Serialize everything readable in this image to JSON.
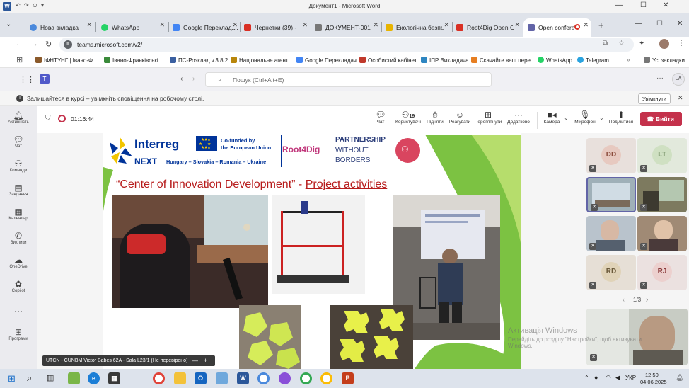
{
  "word": {
    "title": "Документ1 - Microsoft Word",
    "app_icon": "W",
    "quick_access": [
      "↶",
      "↷",
      "⊙",
      "▾"
    ],
    "window_controls": [
      "—",
      "☐",
      "✕"
    ]
  },
  "browser": {
    "tabs": [
      {
        "label": "Нова вкладка",
        "icon": "chrome-icon",
        "color": "#4a89dc"
      },
      {
        "label": "WhatsApp",
        "icon": "whatsapp-icon",
        "color": "#25d366"
      },
      {
        "label": "Google Перекладач",
        "icon": "translate-icon",
        "color": "#4285f4"
      },
      {
        "label": "Чернетки (39) - ",
        "icon": "gmail-icon",
        "color": "#d93025"
      },
      {
        "label": "ДОКУМЕНТ-001",
        "icon": "doc-icon",
        "color": "#555555"
      },
      {
        "label": "Екологічна безпе",
        "icon": "bookmark-icon",
        "color": "#e8b400"
      },
      {
        "label": "Root4Dig Open C",
        "icon": "gmail-icon",
        "color": "#d93025"
      },
      {
        "label": "Open confere",
        "icon": "teams-icon",
        "color": "#6264a7"
      }
    ],
    "new_tab": "+",
    "url": "teams.microsoft.com/v2/",
    "bookmarks": [
      {
        "label": "ІФНТУНГ | Івано-Ф...",
        "color": "#8b5a2b"
      },
      {
        "label": "Івано-Франківські...",
        "color": "#3a8a3a"
      },
      {
        "label": "ПС-Розклад v.3.8.2",
        "color": "#3a5fa0"
      },
      {
        "label": "Національне агент...",
        "color": "#b8860b"
      },
      {
        "label": "Google Перекладач",
        "color": "#4285f4"
      },
      {
        "label": "Особистий кабінет",
        "color": "#c0392b"
      },
      {
        "label": "ІПР Викладача",
        "color": "#2e86c1"
      },
      {
        "label": "Скачайте ваш пере...",
        "color": "#e67e22"
      },
      {
        "label": "WhatsApp",
        "color": "#25d366"
      },
      {
        "label": "Telegram",
        "color": "#2aa3df"
      }
    ],
    "all_bookmarks": "Усі закладки"
  },
  "teams": {
    "search_placeholder": "Пошук (Ctrl+Alt+E)",
    "avatar_initials": "LA",
    "notification": "Залишайтеся в курсі – увімкніть сповіщення на робочому столі.",
    "notification_button": "Увімкнути",
    "rail": [
      "Активність",
      "Чат",
      "Команди",
      "Завдання",
      "Календар",
      "Виклики",
      "OneDrive",
      "Copilot",
      "Програми"
    ]
  },
  "meeting": {
    "timer": "01:16:44",
    "toolbar": [
      {
        "label": "Чат",
        "icon": "chat-icon"
      },
      {
        "label": "Користувачі",
        "icon": "people-icon",
        "count": "19"
      },
      {
        "label": "Підняти",
        "icon": "hand-icon"
      },
      {
        "label": "Реагувати",
        "icon": "emoji-icon"
      },
      {
        "label": "Переглянути",
        "icon": "grid-icon"
      },
      {
        "label": "Додатково",
        "icon": "more-icon"
      },
      {
        "label": "Камера",
        "icon": "camera-icon"
      },
      {
        "label": "Мікрофон",
        "icon": "mic-off-icon"
      },
      {
        "label": "Поділитися",
        "icon": "share-icon"
      }
    ],
    "leave_label": "Вийти",
    "presenter_caption": "UTCN - CUNBM Victor Babes 62A - Sala L23/1 (Не перевірено)",
    "participants": [
      {
        "initials": "DD"
      },
      {
        "initials": "LT"
      },
      {
        "initials": "RD"
      },
      {
        "initials": "RJ"
      }
    ],
    "pager": "1/3"
  },
  "slide": {
    "interreg": "Interreg",
    "next": "NEXT",
    "cofunded_line1": "Co-funded by",
    "cofunded_line2": "the European Union",
    "countries": "Hungary – Slovakia – Romania – Ukraine",
    "project": "Root4Dig",
    "partnership": "PARTNERSHIP",
    "without": "WITHOUT",
    "borders": "BORDERS",
    "title_quoted": "“Center of Innovation Development” - ",
    "title_underlined": "Project activities"
  },
  "watermark": {
    "line1": "Активація Windows",
    "line2": "Перейдіть до розділу \"Настройки\", щоб активувати",
    "line3": "Windows."
  },
  "taskbar": {
    "time": "12:50",
    "date": "04.06.2025",
    "lang": "УКР"
  }
}
